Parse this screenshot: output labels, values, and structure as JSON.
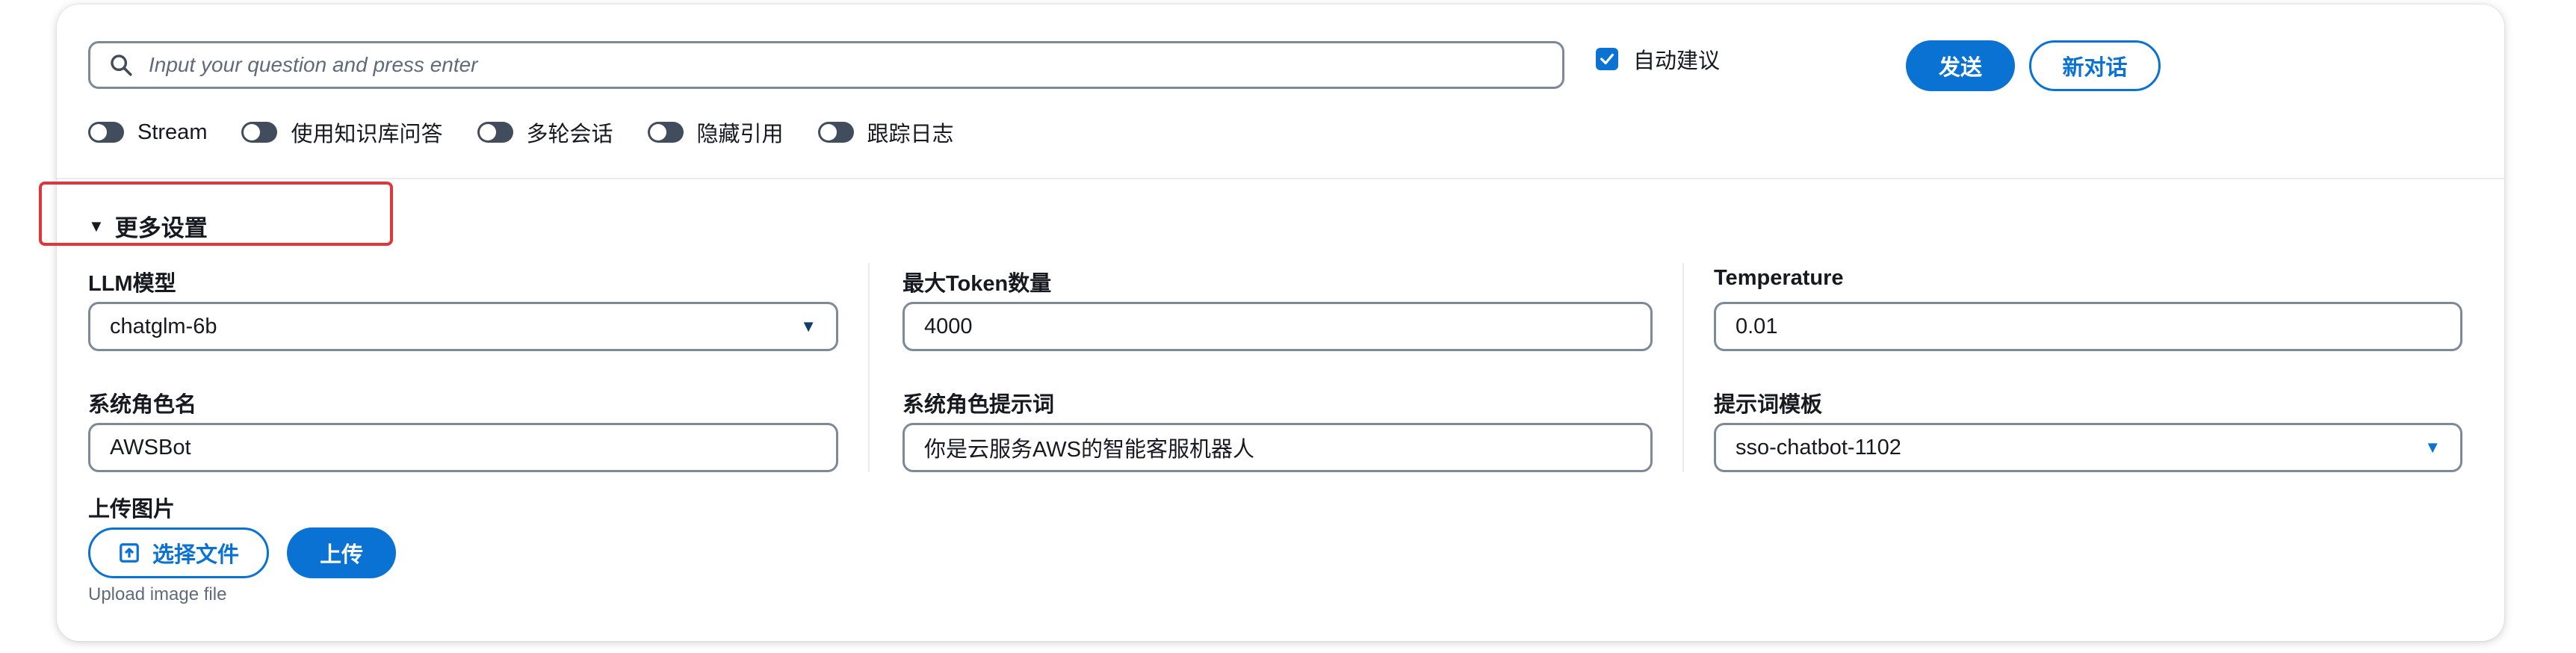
{
  "search": {
    "placeholder": "Input your question and press enter"
  },
  "auto_suggest": {
    "label": "自动建议",
    "checked": true
  },
  "buttons": {
    "send": "发送",
    "new_chat": "新对话",
    "choose_file": "选择文件",
    "upload": "上传"
  },
  "toggles": [
    {
      "label": "Stream",
      "on": false
    },
    {
      "label": "使用知识库问答",
      "on": false
    },
    {
      "label": "多轮会话",
      "on": false
    },
    {
      "label": "隐藏引用",
      "on": false
    },
    {
      "label": "跟踪日志",
      "on": false
    }
  ],
  "more_settings": {
    "title": "更多设置",
    "expanded": true
  },
  "settings": {
    "llm_model": {
      "label": "LLM模型",
      "value": "chatglm-6b"
    },
    "max_tokens": {
      "label": "最大Token数量",
      "value": "4000"
    },
    "temperature": {
      "label": "Temperature",
      "value": "0.01"
    },
    "system_role_name": {
      "label": "系统角色名",
      "value": "AWSBot"
    },
    "system_role_prompt": {
      "label": "系统角色提示词",
      "value": "你是云服务AWS的智能客服机器人"
    },
    "prompt_template": {
      "label": "提示词模板",
      "value": "sso-chatbot-1102"
    },
    "upload_image": {
      "label": "上传图片",
      "hint": "Upload image file"
    }
  },
  "colors": {
    "accent": "#0972d3",
    "highlight": "#e0353b",
    "toggle_off": "#414d5c"
  },
  "icons": [
    "search-icon",
    "check-icon",
    "caret-down-icon",
    "upload-icon"
  ]
}
